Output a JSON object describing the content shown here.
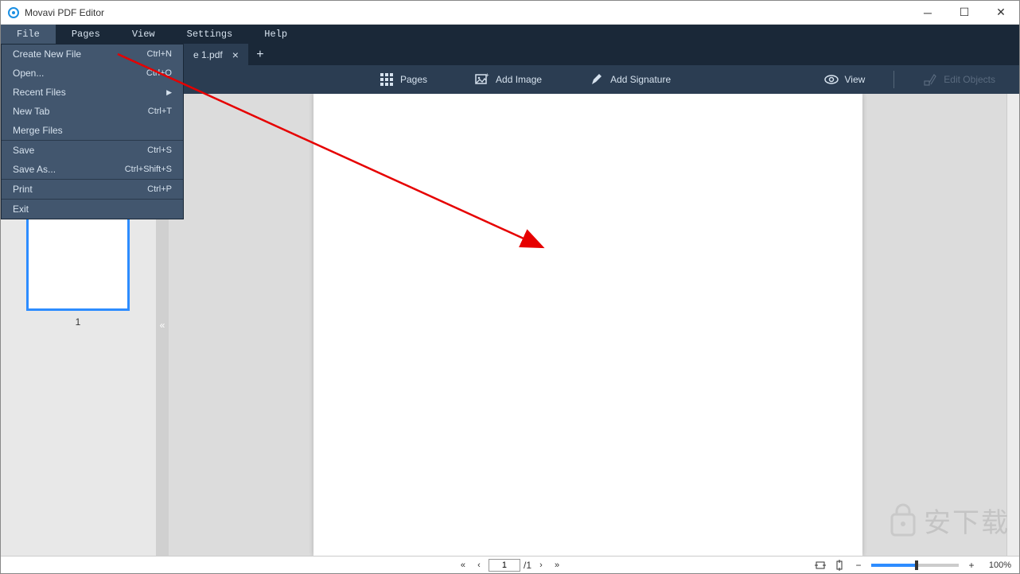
{
  "window": {
    "title": "Movavi PDF Editor"
  },
  "menu": {
    "items": [
      "File",
      "Pages",
      "View",
      "Settings",
      "Help"
    ],
    "active_index": 0
  },
  "file_menu": [
    {
      "label": "Create New File",
      "shortcut": "Ctrl+N"
    },
    {
      "label": "Open...",
      "shortcut": "Ctrl+O"
    },
    {
      "label": "Recent Files",
      "submenu": true
    },
    {
      "label": "New Tab",
      "shortcut": "Ctrl+T"
    },
    {
      "label": "Merge Files"
    },
    {
      "sep": true
    },
    {
      "label": "Save",
      "shortcut": "Ctrl+S"
    },
    {
      "label": "Save As...",
      "shortcut": "Ctrl+Shift+S"
    },
    {
      "sep": true
    },
    {
      "label": "Print",
      "shortcut": "Ctrl+P"
    },
    {
      "sep": true
    },
    {
      "label": "Exit"
    }
  ],
  "tabs": {
    "open": [
      {
        "label": "e 1.pdf"
      }
    ]
  },
  "toolbar": {
    "pages": "Pages",
    "add_image": "Add Image",
    "add_signature": "Add Signature",
    "view": "View",
    "edit_objects": "Edit Objects"
  },
  "sidebar": {
    "thumbnails": [
      {
        "num": "1"
      }
    ]
  },
  "status": {
    "page_current": "1",
    "page_total": "1",
    "zoom": "100%"
  },
  "watermark": {
    "text": "安下载"
  }
}
